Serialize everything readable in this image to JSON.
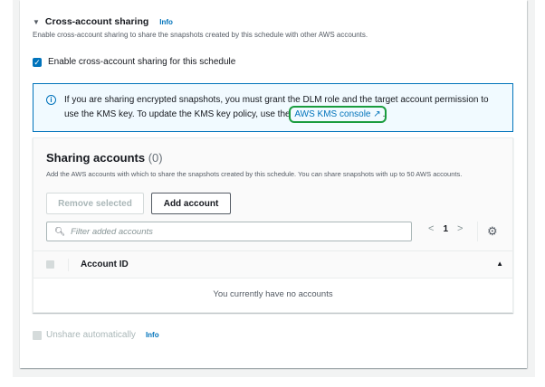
{
  "section": {
    "title": "Cross-account sharing",
    "info": "Info",
    "description": "Enable cross-account sharing to share the snapshots created by this schedule with other AWS accounts."
  },
  "enable_checkbox": {
    "label": "Enable cross-account sharing for this schedule",
    "checked": true
  },
  "alert": {
    "text": "If you are sharing encrypted snapshots, you must grant the DLM role and the target account permission to use the KMS key. To update the KMS key policy, use the",
    "link": "AWS KMS console",
    "suffix": "."
  },
  "sharing_accounts": {
    "title": "Sharing accounts",
    "count": "(0)",
    "description": "Add the AWS accounts with which to share the snapshots created by this schedule. You can share snapshots with up to 50 AWS accounts.",
    "remove_button": "Remove selected",
    "add_button": "Add account",
    "filter_placeholder": "Filter added accounts",
    "page": "1",
    "column": "Account ID",
    "empty": "You currently have no accounts"
  },
  "unshare": {
    "label": "Unshare automatically",
    "info": "Info",
    "checked": false
  }
}
